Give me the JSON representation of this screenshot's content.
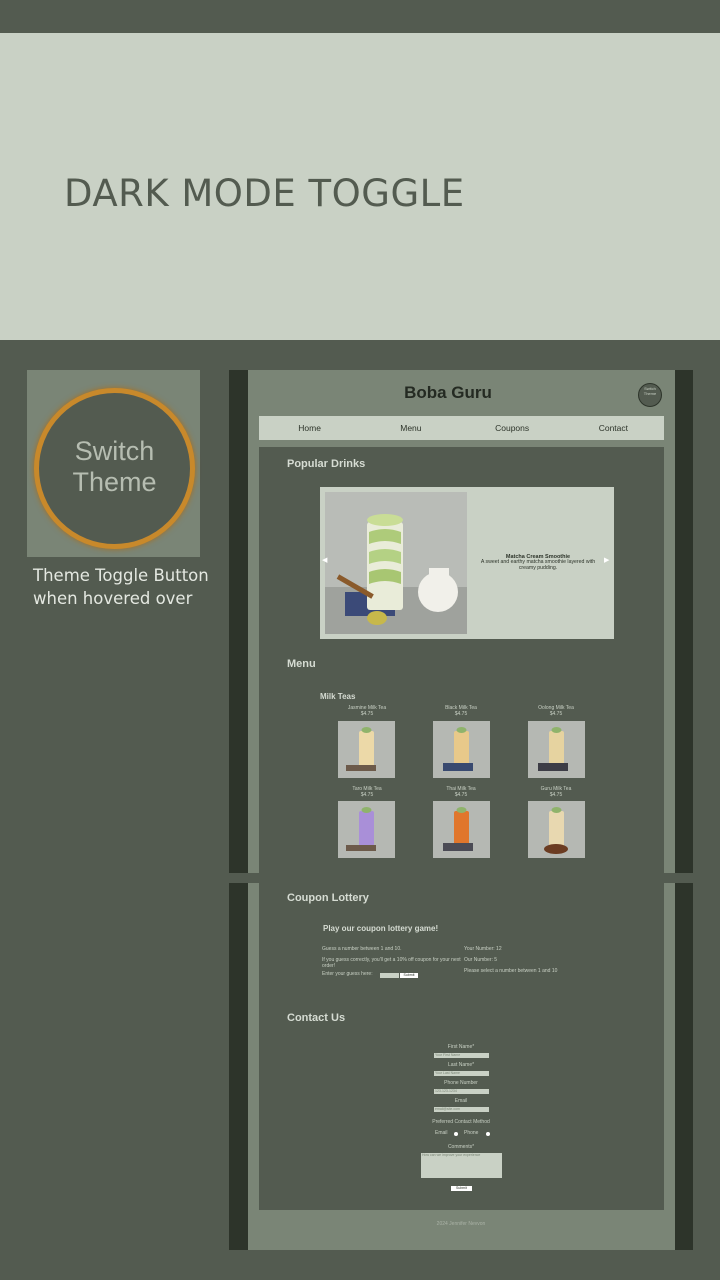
{
  "banner": {
    "title": "DARK MODE TOGGLE"
  },
  "hover_demo": {
    "button_line1": "Switch",
    "button_line2": "Theme",
    "caption_line1": "Theme Toggle Button",
    "caption_line2": "when hovered over"
  },
  "site": {
    "title": "Boba Guru",
    "toggle_line1": "Switch",
    "toggle_line2": "Theme",
    "nav": [
      "Home",
      "Menu",
      "Coupons",
      "Contact"
    ],
    "popular": {
      "heading": "Popular Drinks",
      "slide_title": "Matcha Cream Smoothie",
      "slide_desc": "A sweet and earthy matcha smoothie layered with creamy pudding."
    },
    "menu": {
      "heading": "Menu",
      "category": "Milk Teas",
      "items": [
        {
          "name": "Jasmine Milk Tea",
          "price": "$4.75",
          "color": "#ecd9a8"
        },
        {
          "name": "Black Milk Tea",
          "price": "$4.75",
          "color": "#e8c98a"
        },
        {
          "name": "Oolong Milk Tea",
          "price": "$4.75",
          "color": "#e6d3a0"
        },
        {
          "name": "Taro Milk Tea",
          "price": "$4.75",
          "color": "#a98fd8"
        },
        {
          "name": "Thai Milk Tea",
          "price": "$4.75",
          "color": "#e0762c"
        },
        {
          "name": "Guru Milk Tea",
          "price": "$4.75",
          "color": "#e8d8b0"
        }
      ]
    },
    "coupon": {
      "heading": "Coupon Lottery",
      "subheading": "Play our coupon lottery game!",
      "instr1": "Guess a number between 1 and 10.",
      "instr2": "If you guess correctly, you'll get a 10% off coupon for your next order!",
      "enter_label": "Enter your guess here:",
      "submit": "Submit",
      "your_number": "Your Number: 12",
      "our_number": "Our Number: 5",
      "message": "Please select a number between 1 and 10"
    },
    "contact": {
      "heading": "Contact Us",
      "first_label": "First Name*",
      "first_ph": "Your First Name",
      "last_label": "Last Name*",
      "last_ph": "Your Last Name",
      "phone_label": "Phone Number",
      "phone_ph": "123-123-1234",
      "email_label": "Email",
      "email_ph": "email@site.com",
      "pref_label": "Preferred Contact Method",
      "pref_email": "Email",
      "pref_phone": "Phone",
      "comments_label": "Comments*",
      "comments_ph": "How can we improve your experience",
      "submit": "Submit"
    },
    "footer": "2024 Jennifer Nevvon"
  }
}
